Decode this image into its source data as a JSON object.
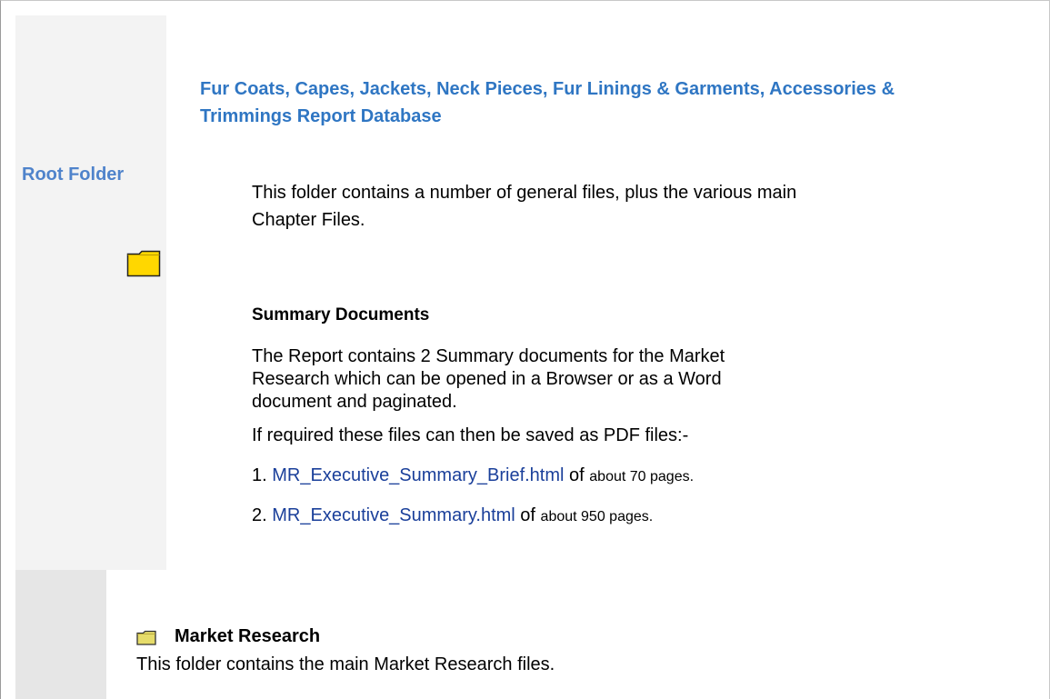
{
  "sidebar": {
    "root_label": "Root Folder",
    "root_icon": "folder-icon"
  },
  "main": {
    "title": "Fur Coats, Capes, Jackets, Neck Pieces, Fur Linings & Garments, Accessories & Trimmings Report Database",
    "intro": "This folder contains a number of general files, plus the various main Chapter Files.",
    "summary": {
      "heading": "Summary Documents",
      "description": "The Report contains 2 Summary documents for the Market Research which can be opened in a Browser or as a Word document and paginated.",
      "pdf_note": "If required these files can then be saved as PDF files:-",
      "documents": [
        {
          "number": "1.",
          "link": "MR_Executive_Summary_Brief.html",
          "of": "of",
          "size": "about 70 pages."
        },
        {
          "number": "2.",
          "link": "MR_Executive_Summary.html",
          "of": "of",
          "size": "about 950 pages."
        }
      ]
    }
  },
  "market_research": {
    "icon": "folder-icon",
    "heading": "Market Research",
    "description": "This folder contains the main Market Research files."
  },
  "colors": {
    "title": "#2f76c3",
    "root_label": "#4f83cb",
    "link": "#1a3f9a",
    "folder": "#ffd700"
  }
}
